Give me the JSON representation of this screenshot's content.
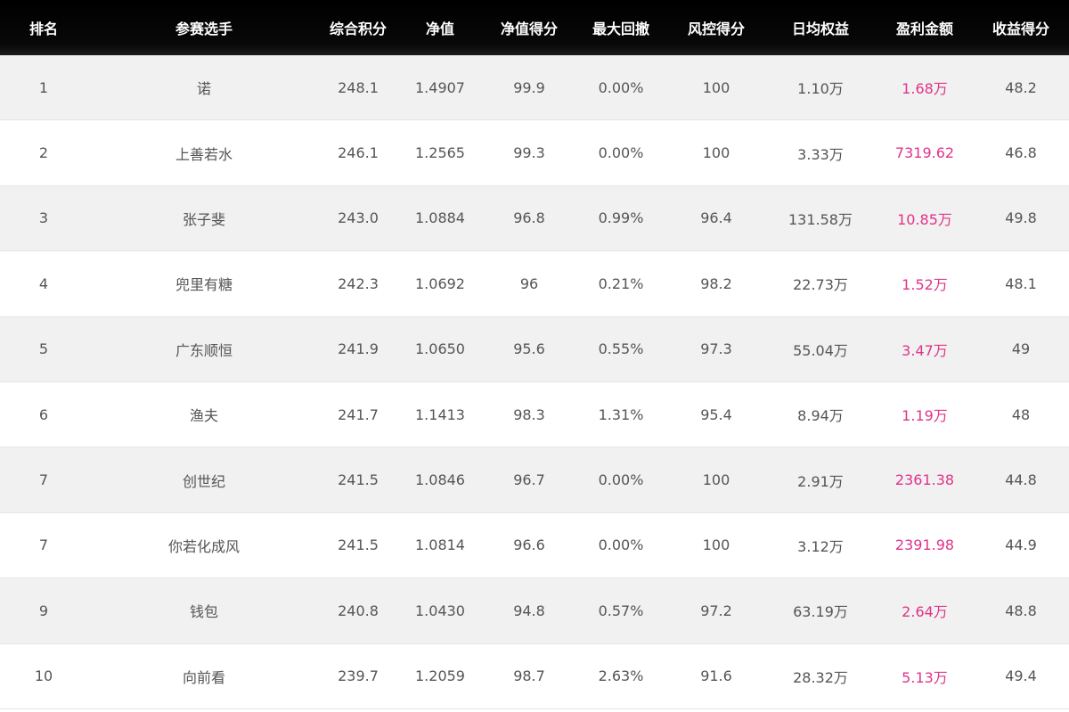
{
  "table": {
    "columns": [
      "排名",
      "参赛选手",
      "综合积分",
      "净值",
      "净值得分",
      "最大回撤",
      "风控得分",
      "日均权益",
      "盈利金额",
      "收益得分"
    ],
    "profit_color": "#e0338a",
    "rows": [
      [
        "1",
        "诺",
        "248.1",
        "1.4907",
        "99.9",
        "0.00%",
        "100",
        "1.10万",
        "1.68万",
        "48.2"
      ],
      [
        "2",
        "上善若水",
        "246.1",
        "1.2565",
        "99.3",
        "0.00%",
        "100",
        "3.33万",
        "7319.62",
        "46.8"
      ],
      [
        "3",
        "张子斐",
        "243.0",
        "1.0884",
        "96.8",
        "0.99%",
        "96.4",
        "131.58万",
        "10.85万",
        "49.8"
      ],
      [
        "4",
        "兜里有糖",
        "242.3",
        "1.0692",
        "96",
        "0.21%",
        "98.2",
        "22.73万",
        "1.52万",
        "48.1"
      ],
      [
        "5",
        "广东顺恒",
        "241.9",
        "1.0650",
        "95.6",
        "0.55%",
        "97.3",
        "55.04万",
        "3.47万",
        "49"
      ],
      [
        "6",
        "渔夫",
        "241.7",
        "1.1413",
        "98.3",
        "1.31%",
        "95.4",
        "8.94万",
        "1.19万",
        "48"
      ],
      [
        "7",
        "创世纪",
        "241.5",
        "1.0846",
        "96.7",
        "0.00%",
        "100",
        "2.91万",
        "2361.38",
        "44.8"
      ],
      [
        "7",
        "你若化成风",
        "241.5",
        "1.0814",
        "96.6",
        "0.00%",
        "100",
        "3.12万",
        "2391.98",
        "44.9"
      ],
      [
        "9",
        "钱包",
        "240.8",
        "1.0430",
        "94.8",
        "0.57%",
        "97.2",
        "63.19万",
        "2.64万",
        "48.8"
      ],
      [
        "10",
        "向前看",
        "239.7",
        "1.2059",
        "98.7",
        "2.63%",
        "91.6",
        "28.32万",
        "5.13万",
        "49.4"
      ]
    ]
  }
}
